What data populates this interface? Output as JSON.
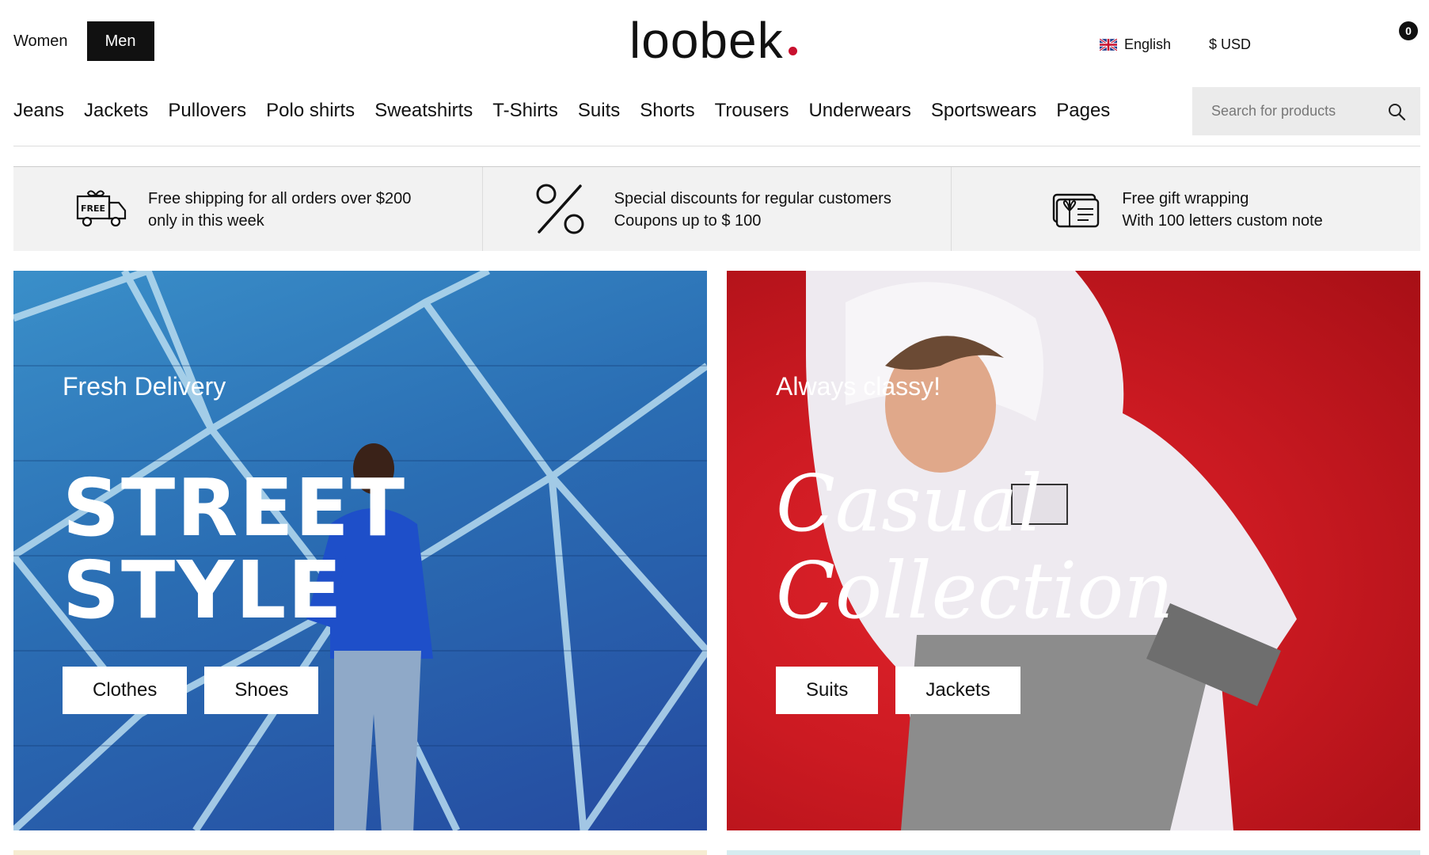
{
  "header": {
    "gender_tabs": [
      {
        "label": "Women"
      },
      {
        "label": "Men"
      }
    ],
    "logo": "loobek",
    "language": "English",
    "currency": "$ USD",
    "cart_count": "0",
    "flag_icon": "uk-flag-icon"
  },
  "nav": {
    "items": [
      "Jeans",
      "Jackets",
      "Pullovers",
      "Polo shirts",
      "Sweatshirts",
      "T-Shirts",
      "Suits",
      "Shorts",
      "Trousers",
      "Underwears",
      "Sportswears",
      "Pages"
    ],
    "search_placeholder": "Search for products",
    "search_icon": "search-icon"
  },
  "features": [
    {
      "icon": "free-truck-icon",
      "line1": "Free shipping for all orders over $200",
      "line2": "only in this week"
    },
    {
      "icon": "percent-icon",
      "line1": "Special discounts for regular customers",
      "line2": "Coupons up to $ 100"
    },
    {
      "icon": "gift-card-icon",
      "line1": "Free gift wrapping",
      "line2": "With 100 letters custom note"
    }
  ],
  "banners": [
    {
      "kicker": "Fresh Delivery",
      "headline_1": "STREET",
      "headline_2": "STYLE",
      "buttons": [
        "Clothes",
        "Shoes"
      ]
    },
    {
      "kicker": "Always classy!",
      "headline_1": "Casual",
      "headline_2": "Collection",
      "buttons": [
        "Suits",
        "Jackets"
      ]
    }
  ],
  "colors": {
    "accent_dot": "#c8102e",
    "left_banner": "#2a6db3",
    "right_banner": "#cc1a22"
  }
}
